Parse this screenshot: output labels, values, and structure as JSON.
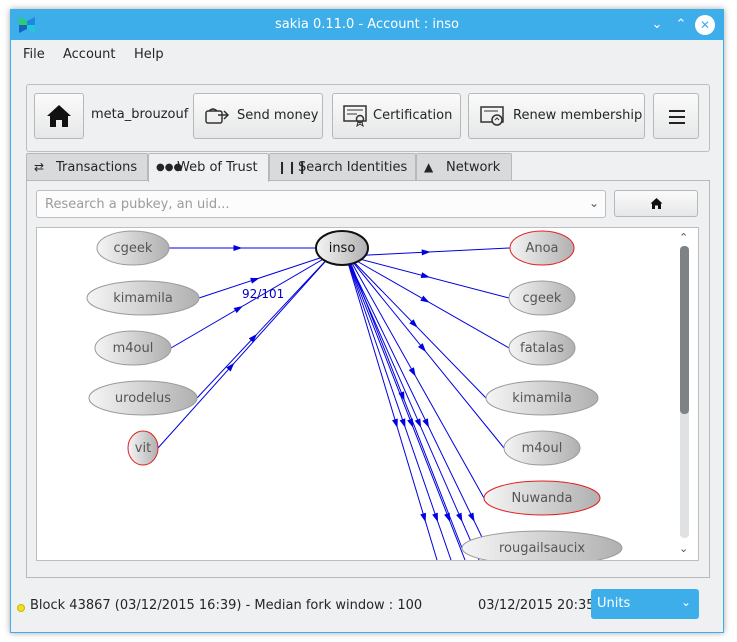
{
  "window": {
    "title": "sakia 0.11.0 - Account : inso"
  },
  "menu": {
    "file": "File",
    "account": "Account",
    "help": "Help"
  },
  "toolbar": {
    "account_name": "meta_brouzouf",
    "send_money": "Send money",
    "certification": "Certification",
    "renew_membership": "Renew membership"
  },
  "tabs": [
    {
      "label": "Transactions",
      "icon": "transfer-arrows-icon"
    },
    {
      "label": "Web of Trust",
      "icon": "web-of-trust-icon"
    },
    {
      "label": "Search Identities",
      "icon": "people-icon"
    },
    {
      "label": "Network",
      "icon": "network-icon"
    }
  ],
  "search": {
    "placeholder": "Research a pubkey, an uid..."
  },
  "graph": {
    "center": "inso",
    "edge_label": "92/101",
    "certifiers": [
      "cgeek",
      "kimamila",
      "m4oul",
      "urodelus",
      "vit"
    ],
    "certified": [
      "Anoa",
      "cgeek",
      "fatalas",
      "kimamila",
      "m4oul",
      "Nuwanda",
      "rougailsaucix"
    ],
    "highlighted_nodes": [
      "vit",
      "Anoa",
      "Nuwanda"
    ],
    "colors": {
      "edge": "#0000e0",
      "node_fill": "#d6d6d6",
      "highlight_border": "#e02020"
    }
  },
  "status": {
    "block_text": "Block 43867 (03/12/2015 16:39) - Median fork window : 100",
    "datetime": "03/12/2015 20:35",
    "units": "Units"
  },
  "colors": {
    "accent": "#3daee9",
    "window_bg": "#eff0f1"
  }
}
